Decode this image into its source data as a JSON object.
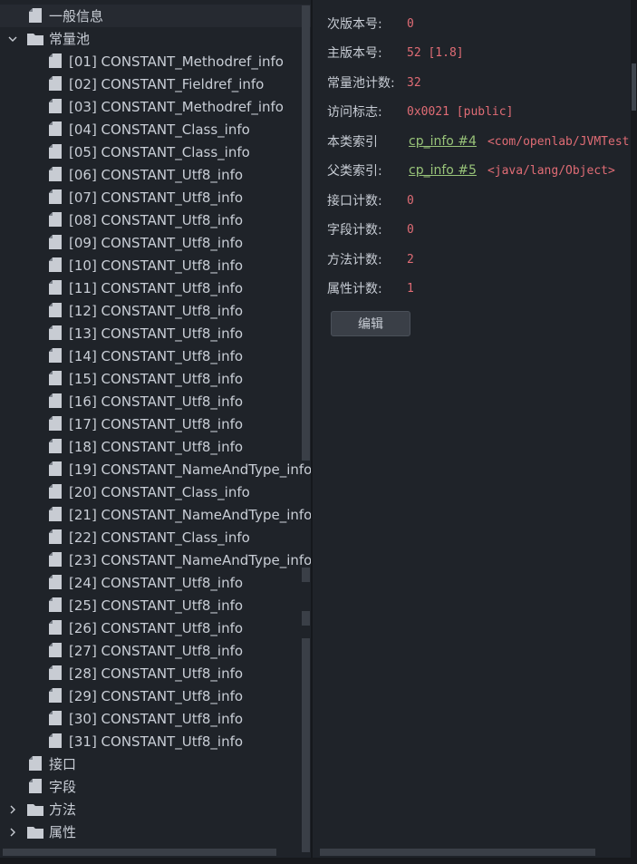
{
  "tree": {
    "items": [
      {
        "label": "一般信息",
        "level": 0,
        "icon": "file-icon",
        "expander": "none",
        "selected": true
      },
      {
        "label": "常量池",
        "level": 0,
        "icon": "folder-icon",
        "expander": "expanded",
        "selected": false
      },
      {
        "label": "[01] CONSTANT_Methodref_info",
        "level": 1,
        "icon": "file-icon",
        "expander": "none"
      },
      {
        "label": "[02] CONSTANT_Fieldref_info",
        "level": 1,
        "icon": "file-icon",
        "expander": "none"
      },
      {
        "label": "[03] CONSTANT_Methodref_info",
        "level": 1,
        "icon": "file-icon",
        "expander": "none"
      },
      {
        "label": "[04] CONSTANT_Class_info",
        "level": 1,
        "icon": "file-icon",
        "expander": "none"
      },
      {
        "label": "[05] CONSTANT_Class_info",
        "level": 1,
        "icon": "file-icon",
        "expander": "none"
      },
      {
        "label": "[06] CONSTANT_Utf8_info",
        "level": 1,
        "icon": "file-icon",
        "expander": "none"
      },
      {
        "label": "[07] CONSTANT_Utf8_info",
        "level": 1,
        "icon": "file-icon",
        "expander": "none"
      },
      {
        "label": "[08] CONSTANT_Utf8_info",
        "level": 1,
        "icon": "file-icon",
        "expander": "none"
      },
      {
        "label": "[09] CONSTANT_Utf8_info",
        "level": 1,
        "icon": "file-icon",
        "expander": "none"
      },
      {
        "label": "[10] CONSTANT_Utf8_info",
        "level": 1,
        "icon": "file-icon",
        "expander": "none"
      },
      {
        "label": "[11] CONSTANT_Utf8_info",
        "level": 1,
        "icon": "file-icon",
        "expander": "none"
      },
      {
        "label": "[12] CONSTANT_Utf8_info",
        "level": 1,
        "icon": "file-icon",
        "expander": "none"
      },
      {
        "label": "[13] CONSTANT_Utf8_info",
        "level": 1,
        "icon": "file-icon",
        "expander": "none"
      },
      {
        "label": "[14] CONSTANT_Utf8_info",
        "level": 1,
        "icon": "file-icon",
        "expander": "none"
      },
      {
        "label": "[15] CONSTANT_Utf8_info",
        "level": 1,
        "icon": "file-icon",
        "expander": "none"
      },
      {
        "label": "[16] CONSTANT_Utf8_info",
        "level": 1,
        "icon": "file-icon",
        "expander": "none"
      },
      {
        "label": "[17] CONSTANT_Utf8_info",
        "level": 1,
        "icon": "file-icon",
        "expander": "none"
      },
      {
        "label": "[18] CONSTANT_Utf8_info",
        "level": 1,
        "icon": "file-icon",
        "expander": "none"
      },
      {
        "label": "[19] CONSTANT_NameAndType_info",
        "level": 1,
        "icon": "file-icon",
        "expander": "none"
      },
      {
        "label": "[20] CONSTANT_Class_info",
        "level": 1,
        "icon": "file-icon",
        "expander": "none"
      },
      {
        "label": "[21] CONSTANT_NameAndType_info",
        "level": 1,
        "icon": "file-icon",
        "expander": "none"
      },
      {
        "label": "[22] CONSTANT_Class_info",
        "level": 1,
        "icon": "file-icon",
        "expander": "none"
      },
      {
        "label": "[23] CONSTANT_NameAndType_info",
        "level": 1,
        "icon": "file-icon",
        "expander": "none"
      },
      {
        "label": "[24] CONSTANT_Utf8_info",
        "level": 1,
        "icon": "file-icon",
        "expander": "none"
      },
      {
        "label": "[25] CONSTANT_Utf8_info",
        "level": 1,
        "icon": "file-icon",
        "expander": "none"
      },
      {
        "label": "[26] CONSTANT_Utf8_info",
        "level": 1,
        "icon": "file-icon",
        "expander": "none"
      },
      {
        "label": "[27] CONSTANT_Utf8_info",
        "level": 1,
        "icon": "file-icon",
        "expander": "none"
      },
      {
        "label": "[28] CONSTANT_Utf8_info",
        "level": 1,
        "icon": "file-icon",
        "expander": "none"
      },
      {
        "label": "[29] CONSTANT_Utf8_info",
        "level": 1,
        "icon": "file-icon",
        "expander": "none"
      },
      {
        "label": "[30] CONSTANT_Utf8_info",
        "level": 1,
        "icon": "file-icon",
        "expander": "none"
      },
      {
        "label": "[31] CONSTANT_Utf8_info",
        "level": 1,
        "icon": "file-icon",
        "expander": "none"
      },
      {
        "label": "接口",
        "level": 0,
        "icon": "file-icon",
        "expander": "none"
      },
      {
        "label": "字段",
        "level": 0,
        "icon": "file-icon",
        "expander": "none"
      },
      {
        "label": "方法",
        "level": 0,
        "icon": "folder-icon",
        "expander": "collapsed"
      },
      {
        "label": "属性",
        "level": 0,
        "icon": "folder-icon",
        "expander": "collapsed"
      }
    ]
  },
  "details": {
    "minor_version": {
      "label": "次版本号:",
      "value": "0"
    },
    "major_version": {
      "label": "主版本号:",
      "value": "52 [1.8]"
    },
    "constant_pool_count": {
      "label": "常量池计数:",
      "value": "32"
    },
    "access_flags": {
      "label": "访问标志:",
      "value": "0x0021 [public]"
    },
    "this_class": {
      "label": "本类索引",
      "link": "cp_info #4",
      "value": "<com/openlab/JVMTest"
    },
    "super_class": {
      "label": "父类索引:",
      "link": "cp_info #5",
      "value": "<java/lang/Object>"
    },
    "interfaces_count": {
      "label": "接口计数:",
      "value": "0"
    },
    "fields_count": {
      "label": "字段计数:",
      "value": "0"
    },
    "methods_count": {
      "label": "方法计数:",
      "value": "2"
    },
    "attributes_count": {
      "label": "属性计数:",
      "value": "1"
    },
    "edit_button": "编辑"
  },
  "colors": {
    "background": "#1f2329",
    "value_red": "#e06c75",
    "link_green": "#98c379",
    "text": "#c7ccd4"
  }
}
